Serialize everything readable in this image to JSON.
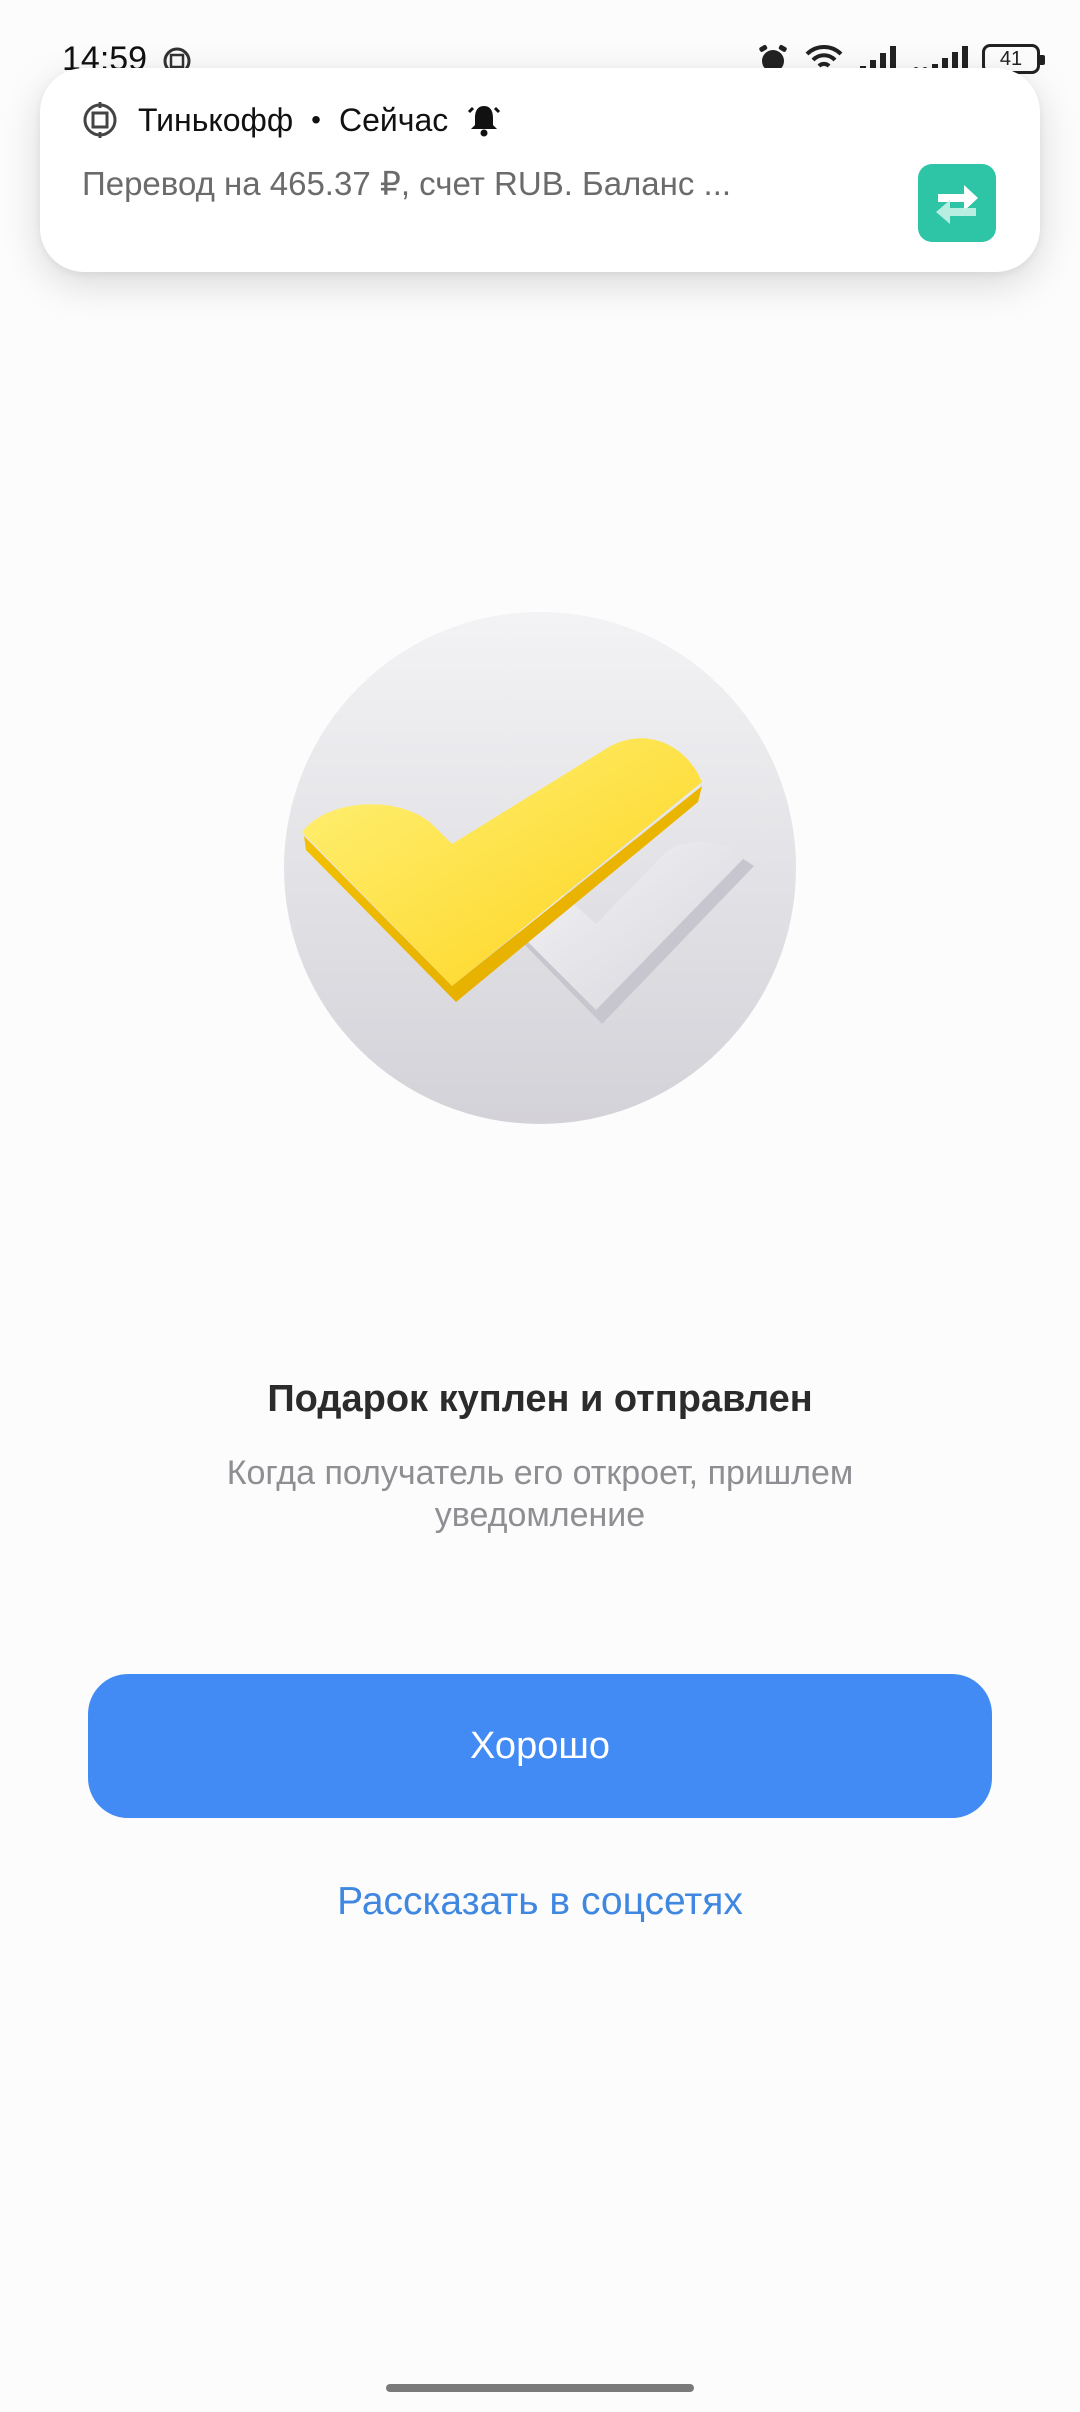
{
  "status_bar": {
    "time": "14:59",
    "battery": "41"
  },
  "notification": {
    "app_name": "Тинькофф",
    "separator": "•",
    "time": "Сейчас",
    "text": "Перевод на 465.37 ₽, счет RUB. Баланс ..."
  },
  "main": {
    "title": "Подарок куплен и отправлен",
    "subtitle": "Когда получатель его откроет, пришлем уведомление",
    "ok_button_label": "Хорошо",
    "share_link_label": "Рассказать в соцсетях"
  },
  "colors": {
    "accent": "#428bf5",
    "link": "#3f87e0",
    "notification_icon": "#2ec4a6",
    "check_yellow": "#fddb2e"
  }
}
